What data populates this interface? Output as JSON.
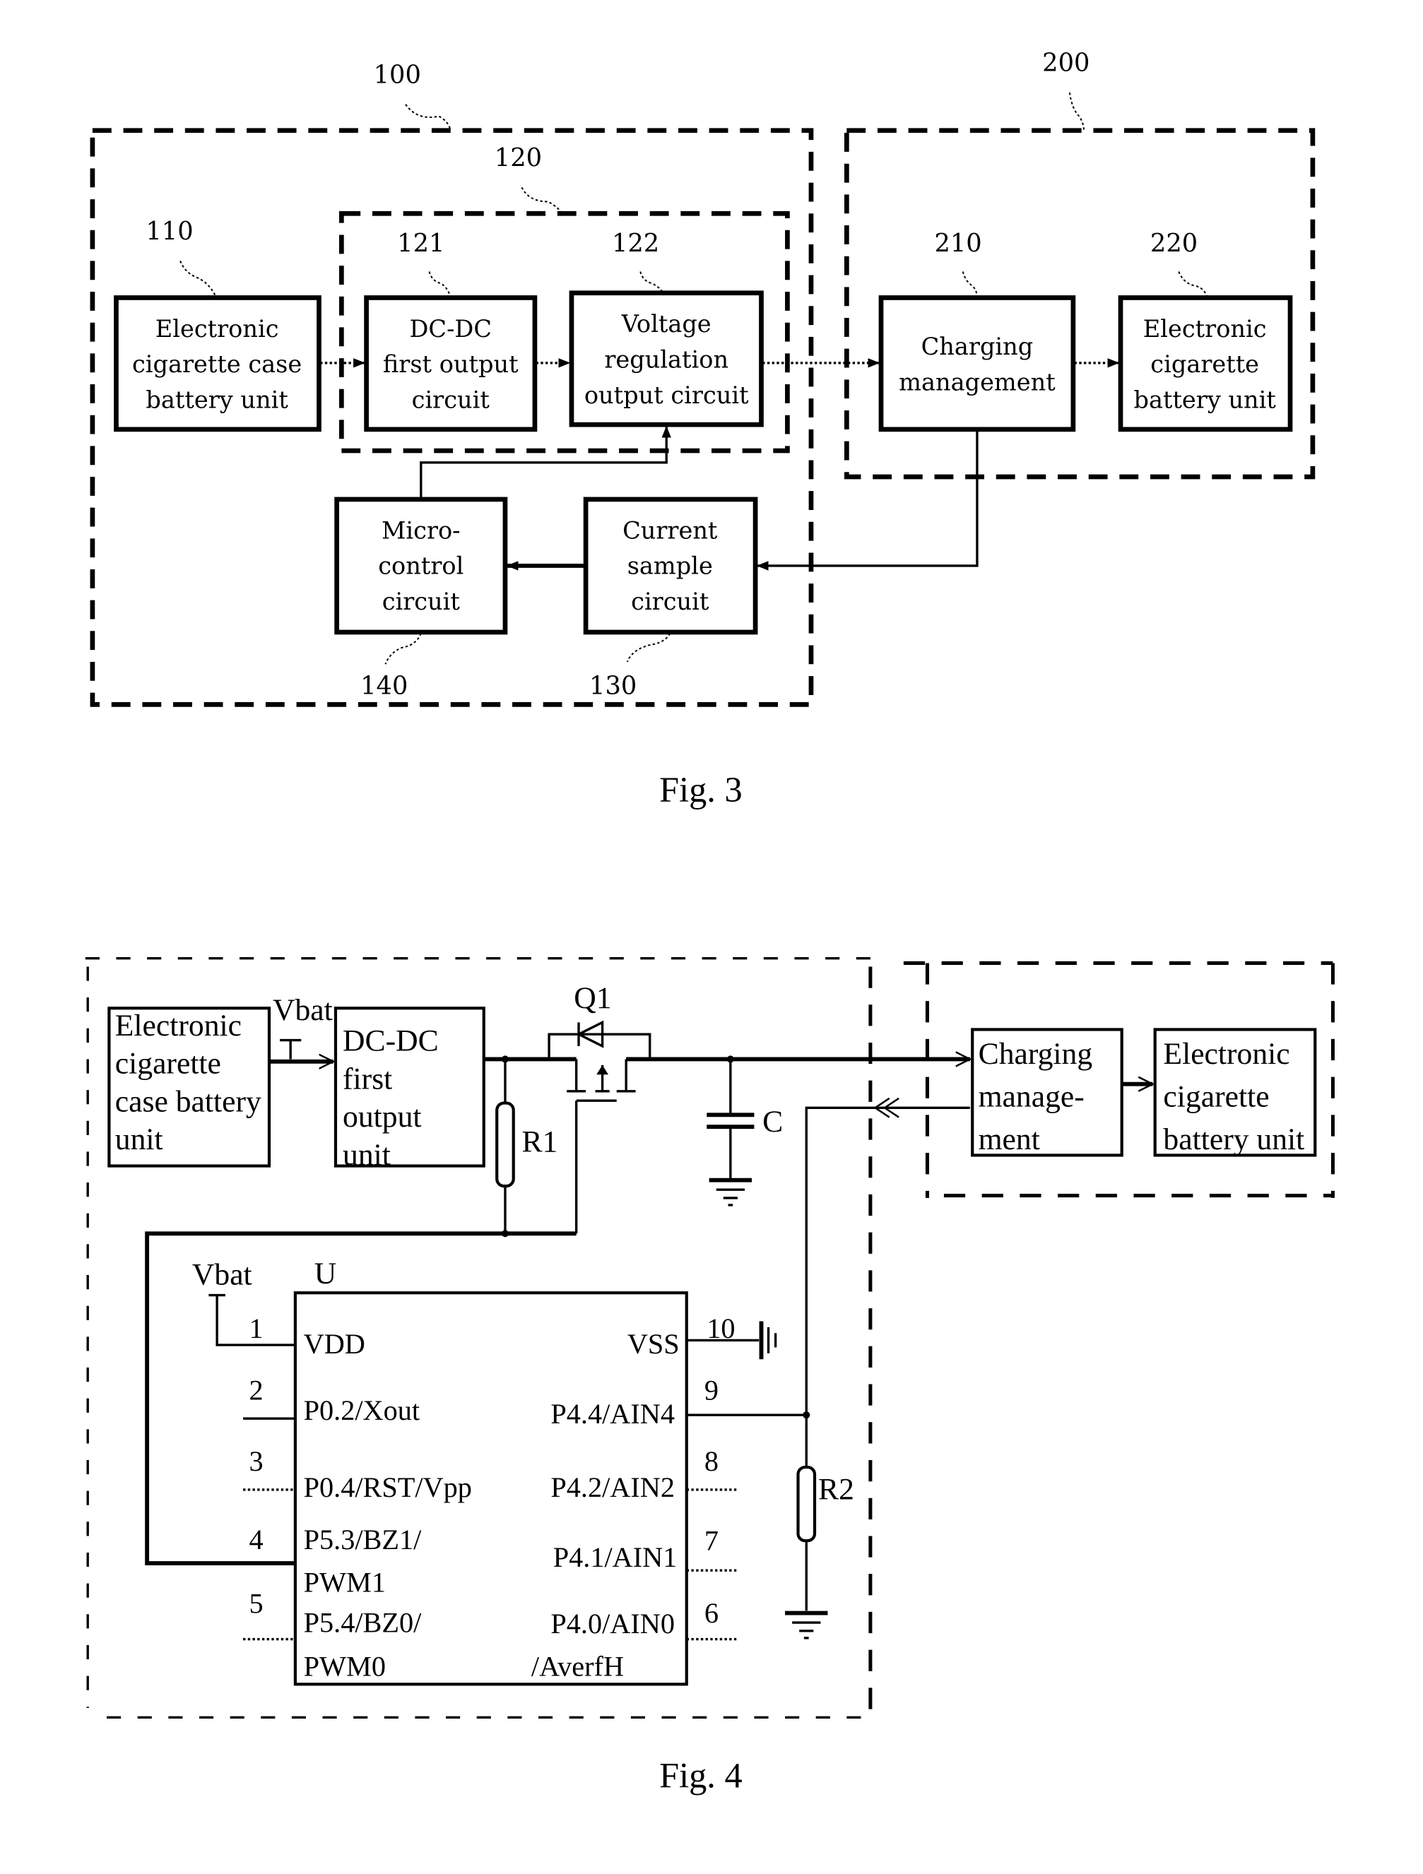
{
  "fig3": {
    "caption": "Fig. 3",
    "groups": {
      "g100": "100",
      "g120": "120",
      "g200": "200"
    },
    "blocks": [
      {
        "id": "110",
        "lines": [
          "Electronic",
          "cigarette case",
          "battery unit"
        ]
      },
      {
        "id": "121",
        "lines": [
          "DC-DC",
          "first output",
          "circuit"
        ]
      },
      {
        "id": "122",
        "lines": [
          "Voltage",
          "regulation",
          "output circuit"
        ]
      },
      {
        "id": "210",
        "lines": [
          "Charging",
          "management"
        ]
      },
      {
        "id": "220",
        "lines": [
          "Electronic",
          "cigarette",
          "battery unit"
        ]
      },
      {
        "id": "140",
        "lines": [
          "Micro-",
          "control",
          "circuit"
        ]
      },
      {
        "id": "130",
        "lines": [
          "Current",
          "sample",
          "circuit"
        ]
      }
    ]
  },
  "fig4": {
    "caption": "Fig. 4",
    "blocks": {
      "battery": [
        "Electronic",
        "cigarette",
        "case battery",
        "unit"
      ],
      "dcdc": [
        "DC-DC",
        "first",
        "output",
        "unit"
      ],
      "charging": [
        "Charging",
        "manage-",
        "ment"
      ],
      "ecig": [
        "Electronic",
        "cigarette",
        "battery unit"
      ]
    },
    "labels": {
      "vbat_top": "Vbat",
      "q1": "Q1",
      "r1": "R1",
      "c": "C",
      "r2": "R2",
      "vbat_chip": "Vbat",
      "chip": "U"
    },
    "pins_left": [
      {
        "num": "1",
        "name": [
          "VDD"
        ]
      },
      {
        "num": "2",
        "name": [
          "P0.2/Xout"
        ]
      },
      {
        "num": "3",
        "name": [
          "P0.4/RST/Vpp"
        ]
      },
      {
        "num": "4",
        "name": [
          "P5.3/BZ1/",
          "PWM1"
        ]
      },
      {
        "num": "5",
        "name": [
          "P5.4/BZ0/",
          "PWM0"
        ]
      }
    ],
    "pins_right": [
      {
        "num": "10",
        "name": [
          "VSS"
        ]
      },
      {
        "num": "9",
        "name": [
          "P4.4/AIN4"
        ]
      },
      {
        "num": "8",
        "name": [
          "P4.2/AIN2"
        ]
      },
      {
        "num": "7",
        "name": [
          "P4.1/AIN1"
        ]
      },
      {
        "num": "6",
        "name": [
          "P4.0/AIN0",
          "/AverfH"
        ]
      }
    ]
  }
}
